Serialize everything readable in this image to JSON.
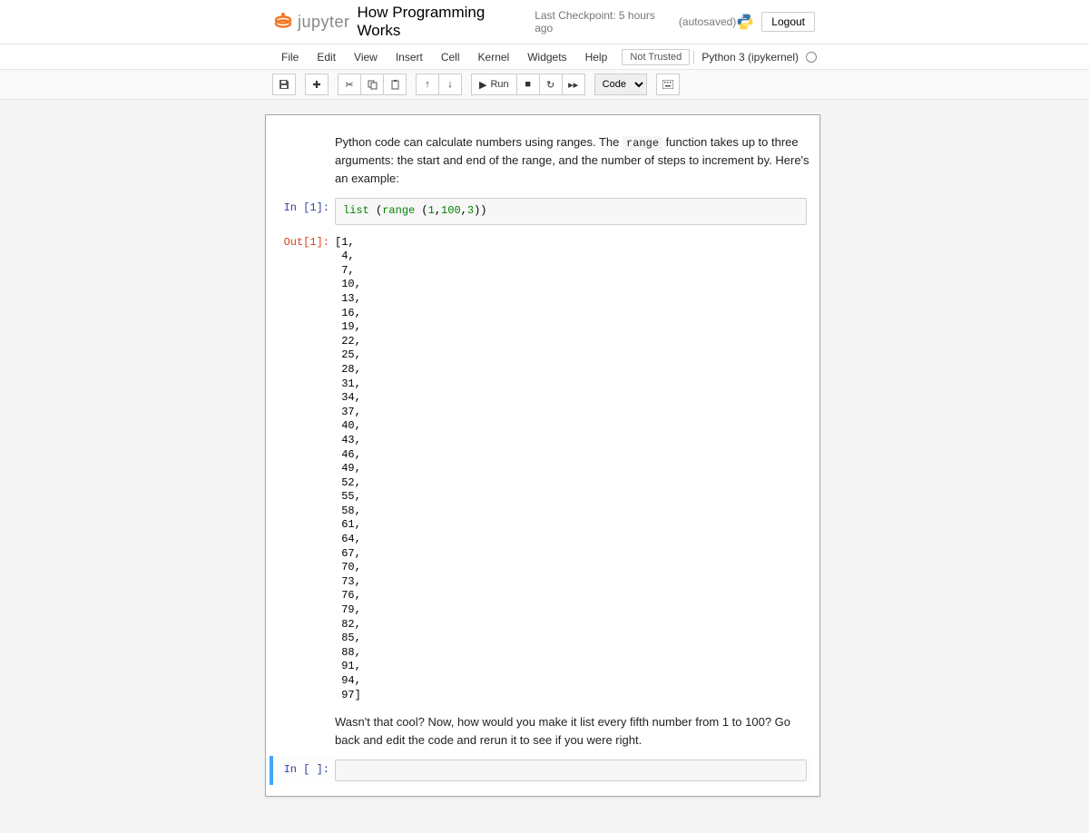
{
  "header": {
    "logo_text": "jupyter",
    "title": "How Programming Works",
    "checkpoint": "Last Checkpoint: 5 hours ago",
    "autosave": "(autosaved)",
    "logout": "Logout"
  },
  "menubar": {
    "items": [
      "File",
      "Edit",
      "View",
      "Insert",
      "Cell",
      "Kernel",
      "Widgets",
      "Help"
    ],
    "trust": "Not Trusted",
    "kernel": "Python 3 (ipykernel)"
  },
  "toolbar": {
    "run": "Run",
    "celltype": "Code"
  },
  "cells": {
    "md1_a": "Python code can calculate numbers using ranges. The ",
    "md1_code": "range",
    "md1_b": " function takes up to three arguments: the start and end of the range, and the number of steps to increment by. Here's an example:",
    "in1_prompt": "In [1]:",
    "code1_a": "list",
    "code1_b": " (",
    "code1_c": "range",
    "code1_d": " (",
    "code1_e": "1",
    "code1_f": ",",
    "code1_g": "100",
    "code1_h": ",",
    "code1_i": "3",
    "code1_j": "))",
    "out1_prompt": "Out[1]:",
    "out1_text": "[1,\n 4,\n 7,\n 10,\n 13,\n 16,\n 19,\n 22,\n 25,\n 28,\n 31,\n 34,\n 37,\n 40,\n 43,\n 46,\n 49,\n 52,\n 55,\n 58,\n 61,\n 64,\n 67,\n 70,\n 73,\n 76,\n 79,\n 82,\n 85,\n 88,\n 91,\n 94,\n 97]",
    "md2": "Wasn't that cool? Now, how would you make it list every fifth number from 1 to 100? Go back and edit the code and rerun it to see if you were right.",
    "in_empty_prompt": "In [ ]:"
  }
}
